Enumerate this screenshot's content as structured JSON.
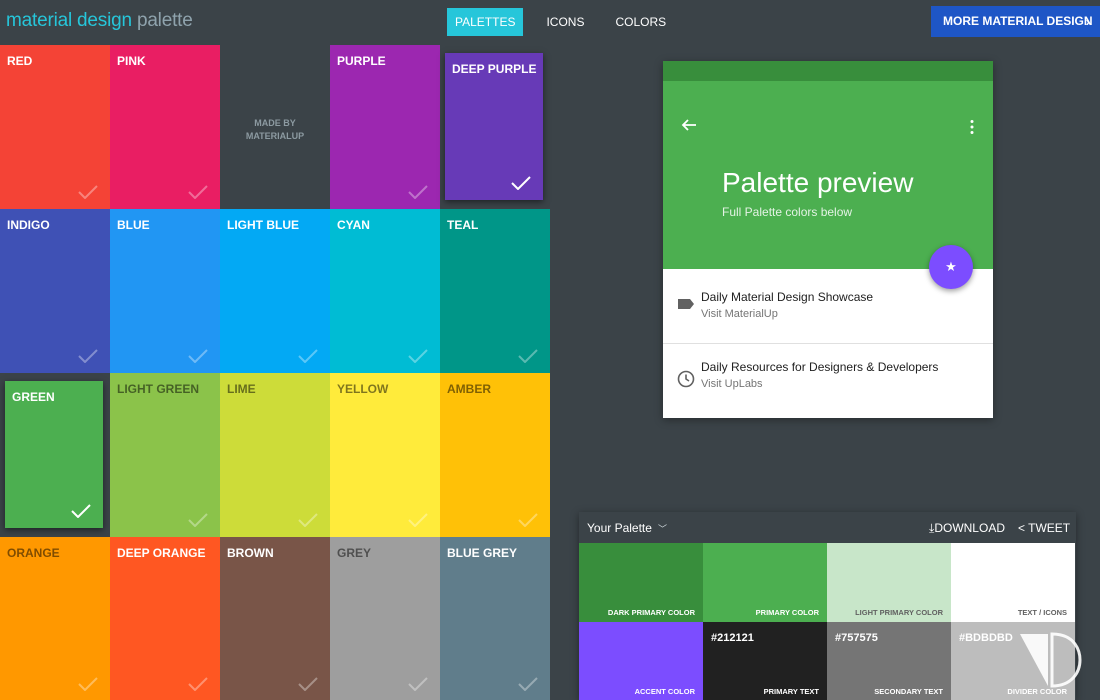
{
  "header": {
    "logo_part1": "material design",
    "logo_part2": "palette",
    "nav": [
      "PALETTES",
      "ICONS",
      "COLORS"
    ],
    "more_button": "MORE MATERIAL DESIGN"
  },
  "grid": {
    "tiles": [
      {
        "name": "RED",
        "color": "#f44336",
        "check": "dim"
      },
      {
        "name": "PINK",
        "color": "#e91e63",
        "check": "dim"
      },
      {
        "name": "",
        "color": "#3b4348",
        "check": "none"
      },
      {
        "name": "PURPLE",
        "color": "#9c27b0",
        "check": "dim"
      },
      {
        "name": "DEEP PURPLE",
        "color": "#673ab7",
        "check": "solid",
        "selected": true
      },
      {
        "name": "INDIGO",
        "color": "#3f51b5",
        "check": "dim"
      },
      {
        "name": "BLUE",
        "color": "#2196f3",
        "check": "dim"
      },
      {
        "name": "LIGHT BLUE",
        "color": "#03a9f4",
        "check": "dim"
      },
      {
        "name": "CYAN",
        "color": "#00bcd4",
        "check": "dim"
      },
      {
        "name": "TEAL",
        "color": "#009688",
        "check": "dim"
      },
      {
        "name": "GREEN",
        "color": "#4caf50",
        "check": "solid",
        "selected": true
      },
      {
        "name": "LIGHT GREEN",
        "color": "#8bc34a",
        "check": "dim",
        "dark": true
      },
      {
        "name": "LIME",
        "color": "#cddc39",
        "check": "dim",
        "dark": true
      },
      {
        "name": "YELLOW",
        "color": "#ffeb3b",
        "check": "dim",
        "dark": true
      },
      {
        "name": "AMBER",
        "color": "#ffc107",
        "check": "dim",
        "dark": true
      },
      {
        "name": "ORANGE",
        "color": "#ff9800",
        "check": "dim",
        "dark": true
      },
      {
        "name": "DEEP ORANGE",
        "color": "#ff5722",
        "check": "dim"
      },
      {
        "name": "BROWN",
        "color": "#795548",
        "check": "dim"
      },
      {
        "name": "GREY",
        "color": "#9e9e9e",
        "check": "dim",
        "dark": true
      },
      {
        "name": "BLUE GREY",
        "color": "#607d8b",
        "check": "dim"
      }
    ],
    "made_by_line1": "MADE BY",
    "made_by_line2": "MATERIALUP"
  },
  "preview": {
    "title": "Palette preview",
    "subtitle": "Full Palette colors below",
    "fab_icon": "star-icon",
    "item1_title": "Daily Material Design Showcase",
    "item1_sub": "Visit MaterialUp",
    "item2_title": "Daily Resources for Designers & Developers",
    "item2_sub": "Visit UpLabs"
  },
  "palette": {
    "title": "Your Palette",
    "download": "DOWNLOAD",
    "tweet": "TWEET",
    "swatches": [
      {
        "label": "DARK PRIMARY COLOR",
        "color": "#388e3c",
        "hex": ""
      },
      {
        "label": "PRIMARY COLOR",
        "color": "#4caf50",
        "hex": ""
      },
      {
        "label": "LIGHT PRIMARY COLOR",
        "color": "#c8e6c9",
        "hex": "",
        "dark": true
      },
      {
        "label": "TEXT / ICONS",
        "color": "#ffffff",
        "hex": "",
        "dark": true
      },
      {
        "label": "ACCENT COLOR",
        "color": "#7c4dff",
        "hex": ""
      },
      {
        "label": "PRIMARY TEXT",
        "color": "#212121",
        "hex": "#212121"
      },
      {
        "label": "SECONDARY TEXT",
        "color": "#757575",
        "hex": "#757575"
      },
      {
        "label": "DIVIDER COLOR",
        "color": "#bdbdbd",
        "hex": "#BDBDBD"
      }
    ]
  }
}
